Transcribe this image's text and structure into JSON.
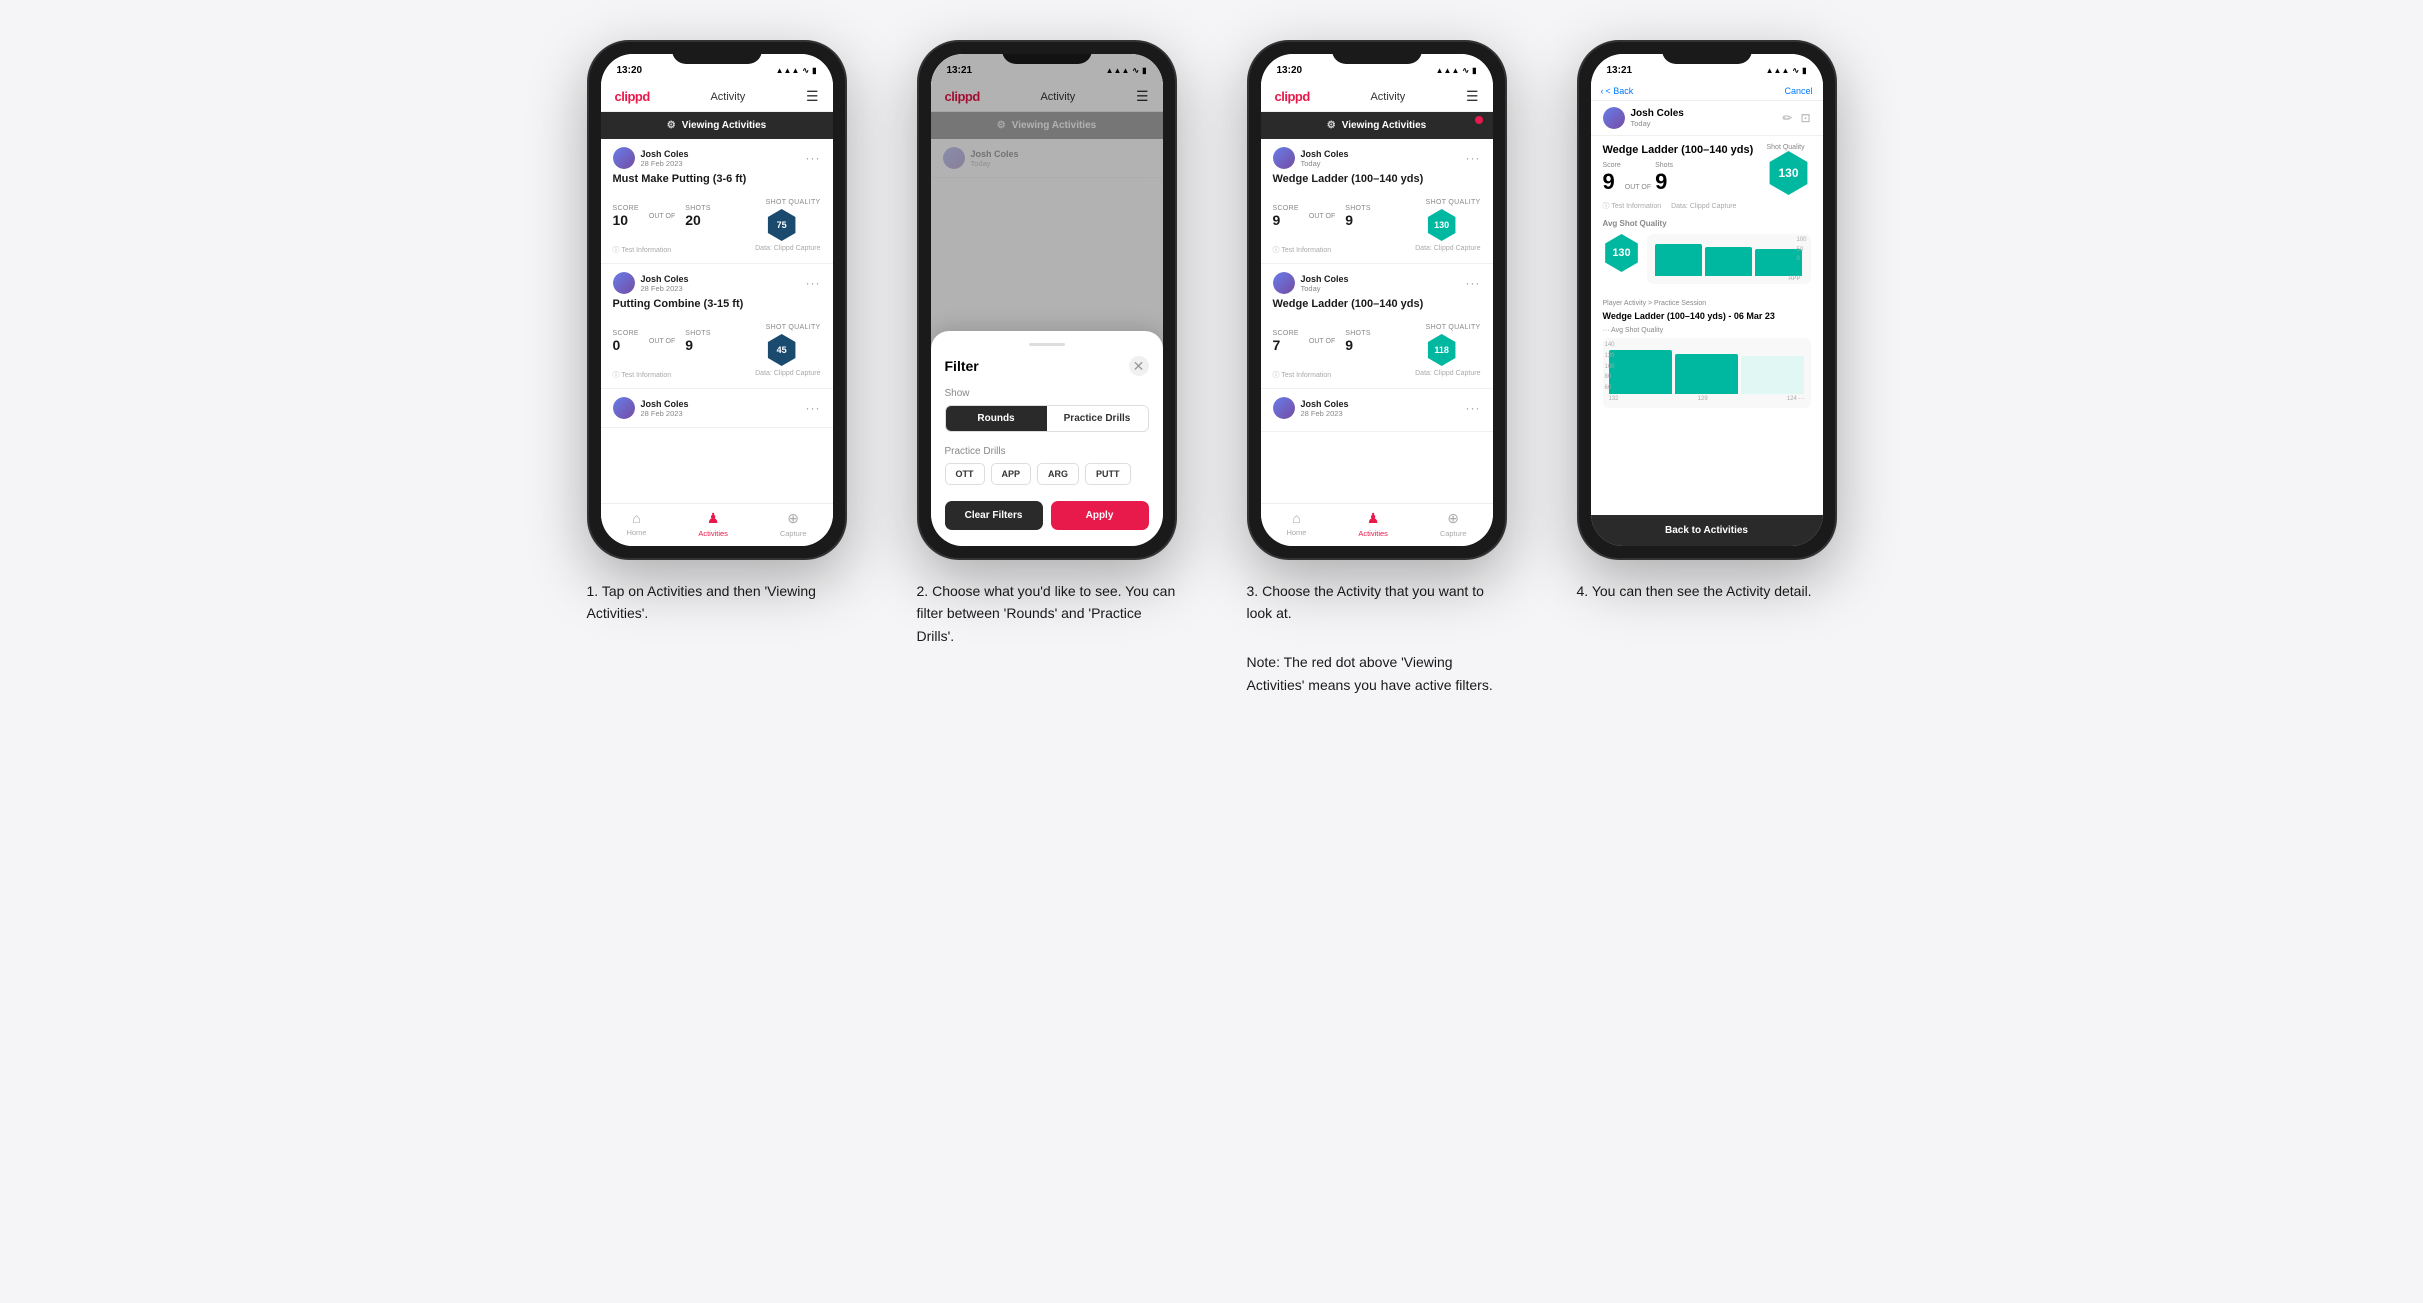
{
  "app": {
    "logo": "clippd",
    "header_title": "Activity",
    "hamburger": "☰"
  },
  "phones": [
    {
      "id": "phone1",
      "status_time": "13:20",
      "viewing_activities_label": "Viewing Activities",
      "has_red_dot": false,
      "cards": [
        {
          "user": "Josh Coles",
          "date": "28 Feb 2023",
          "title": "Must Make Putting (3-6 ft)",
          "score_label": "Score",
          "score": "10",
          "shots_label": "Shots",
          "outof": "OUT OF",
          "shots": "20",
          "quality_label": "Shot Quality",
          "quality": "75",
          "footer_left": "ⓘ Test Information",
          "footer_right": "Data: Clippd Capture"
        },
        {
          "user": "Josh Coles",
          "date": "28 Feb 2023",
          "title": "Putting Combine (3-15 ft)",
          "score_label": "Score",
          "score": "0",
          "shots_label": "Shots",
          "outof": "OUT OF",
          "shots": "9",
          "quality_label": "Shot Quality",
          "quality": "45",
          "footer_left": "ⓘ Test Information",
          "footer_right": "Data: Clippd Capture"
        },
        {
          "user": "Josh Coles",
          "date": "28 Feb 2023",
          "title": "",
          "score_label": "",
          "score": "",
          "shots_label": "",
          "outof": "",
          "shots": "",
          "quality_label": "",
          "quality": ""
        }
      ],
      "nav": [
        "Home",
        "Activities",
        "Capture"
      ],
      "active_nav": 1
    },
    {
      "id": "phone2",
      "status_time": "13:21",
      "viewing_activities_label": "Viewing Activities",
      "filter_title": "Filter",
      "show_label": "Show",
      "toggle_options": [
        "Rounds",
        "Practice Drills"
      ],
      "active_toggle": 0,
      "practice_drills_label": "Practice Drills",
      "drill_options": [
        "OTT",
        "APP",
        "ARG",
        "PUTT"
      ],
      "clear_filters": "Clear Filters",
      "apply": "Apply"
    },
    {
      "id": "phone3",
      "status_time": "13:20",
      "viewing_activities_label": "Viewing Activities",
      "has_red_dot": true,
      "cards": [
        {
          "user": "Josh Coles",
          "date": "Today",
          "title": "Wedge Ladder (100–140 yds)",
          "score_label": "Score",
          "score": "9",
          "shots_label": "Shots",
          "outof": "OUT OF",
          "shots": "9",
          "quality_label": "Shot Quality",
          "quality": "130",
          "quality_teal": true,
          "footer_left": "ⓘ Test Information",
          "footer_right": "Data: Clippd Capture"
        },
        {
          "user": "Josh Coles",
          "date": "Today",
          "title": "Wedge Ladder (100–140 yds)",
          "score_label": "Score",
          "score": "7",
          "shots_label": "Shots",
          "outof": "OUT OF",
          "shots": "9",
          "quality_label": "Shot Quality",
          "quality": "118",
          "quality_teal": true,
          "footer_left": "ⓘ Test Information",
          "footer_right": "Data: Clippd Capture"
        },
        {
          "user": "Josh Coles",
          "date": "28 Feb 2023",
          "title": ""
        }
      ],
      "nav": [
        "Home",
        "Activities",
        "Capture"
      ],
      "active_nav": 1
    },
    {
      "id": "phone4",
      "status_time": "13:21",
      "back_label": "< Back",
      "cancel_label": "Cancel",
      "user": "Josh Coles",
      "date": "Today",
      "detail_title": "Wedge Ladder (100–140 yds)",
      "score_header": "Score",
      "shots_header": "Shots",
      "score_value": "9",
      "outof": "OUT OF",
      "shots_value": "9",
      "quality": "130",
      "info_label": "ⓘ Test Information",
      "data_label": "Data: Clippd Capture",
      "avg_quality_label": "Avg Shot Quality",
      "chart_values": [
        132,
        129,
        124
      ],
      "chart_labels": [
        "",
        "",
        "APP"
      ],
      "y_labels": [
        "100",
        "50",
        "0"
      ],
      "player_activity_label": "Player Activity > Practice Session",
      "session_title": "Wedge Ladder (100–140 yds) - 06 Mar 23",
      "avg_shot_label": "··· Avg Shot Quality",
      "back_to_activities": "Back to Activities"
    }
  ],
  "step_descriptions": [
    {
      "number": "1.",
      "text": "Tap on Activities and then 'Viewing Activities'."
    },
    {
      "number": "2.",
      "text": "Choose what you'd like to see. You can filter between 'Rounds' and 'Practice Drills'."
    },
    {
      "number": "3.",
      "text": "Choose the Activity that you want to look at.\n\nNote: The red dot above 'Viewing Activities' means you have active filters."
    },
    {
      "number": "4.",
      "text": "You can then see the Activity detail."
    }
  ]
}
